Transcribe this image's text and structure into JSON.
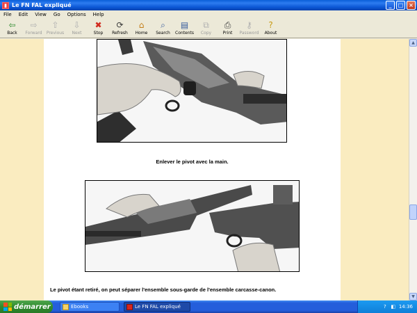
{
  "window": {
    "title": "Le FN FAL expliqué",
    "buttons": {
      "minimize": "_",
      "maximize": "□",
      "close": "×"
    }
  },
  "menu": [
    "File",
    "Edit",
    "View",
    "Go",
    "Options",
    "Help"
  ],
  "toolbar": [
    {
      "label": "Back",
      "icon": "back-arrow-icon",
      "glyph": "⇦",
      "enabled": true,
      "color": "#2e8b2e"
    },
    {
      "label": "Forward",
      "icon": "forward-arrow-icon",
      "glyph": "⇨",
      "enabled": false,
      "color": "#b0b0b0"
    },
    {
      "label": "Previous",
      "icon": "up-arrow-icon",
      "glyph": "⇧",
      "enabled": false,
      "color": "#b0b0b0"
    },
    {
      "label": "Next",
      "icon": "down-arrow-icon",
      "glyph": "⇩",
      "enabled": false,
      "color": "#b0b0b0"
    },
    {
      "label": "Stop",
      "icon": "stop-icon",
      "glyph": "✖",
      "enabled": true,
      "color": "#d12a1e"
    },
    {
      "label": "Refresh",
      "icon": "refresh-icon",
      "glyph": "⟳",
      "enabled": true,
      "color": "#3a3a3a"
    },
    {
      "label": "Home",
      "icon": "home-icon",
      "glyph": "⌂",
      "enabled": true,
      "color": "#c47d16"
    },
    {
      "label": "Search",
      "icon": "search-icon",
      "glyph": "⌕",
      "enabled": true,
      "color": "#355a9c"
    },
    {
      "label": "Contents",
      "icon": "contents-icon",
      "glyph": "▤",
      "enabled": true,
      "color": "#355a9c"
    },
    {
      "label": "Copy",
      "icon": "copy-icon",
      "glyph": "⧉",
      "enabled": false,
      "color": "#b0b0b0"
    },
    {
      "label": "Print",
      "icon": "print-icon",
      "glyph": "⎙",
      "enabled": true,
      "color": "#3a3a3a"
    },
    {
      "label": "Password",
      "icon": "key-icon",
      "glyph": "⚷",
      "enabled": false,
      "color": "#b0b0b0"
    },
    {
      "label": "About",
      "icon": "question-icon",
      "glyph": "?",
      "enabled": true,
      "color": "#c89a10"
    }
  ],
  "document": {
    "caption1": "Enlever le pivot avec la main.",
    "body_text": "Le pivot étant retiré, on peut séparer l'ensemble sous-garde de l'ensemble carcasse-canon.",
    "margin_color": "#faecc0"
  },
  "taskbar": {
    "start_label": "démarrer",
    "tasks": [
      {
        "label": "Ebooks",
        "icon": "folder-icon",
        "active": false
      },
      {
        "label": "Le FN FAL expliqué",
        "icon": "ebook-icon",
        "active": true
      }
    ],
    "language": "FR",
    "clock": "14:36"
  }
}
